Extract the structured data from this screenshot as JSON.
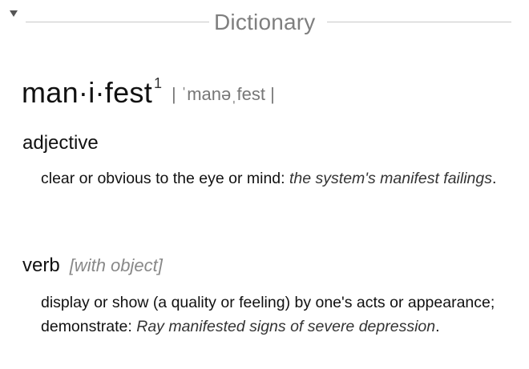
{
  "section": {
    "title": "Dictionary"
  },
  "entry": {
    "headword": "man·i·fest",
    "homograph": "1",
    "pronunciation": "| ˈmanəˌfest |",
    "senses": [
      {
        "pos": "adjective",
        "grammar": "",
        "definition": "clear or obvious to the eye or mind: ",
        "example": "the system's manifest failings",
        "trailing": "."
      },
      {
        "pos": "verb",
        "grammar": "[with object]",
        "definition": "display or show (a quality or feeling) by one's acts or appearance; demonstrate: ",
        "example": "Ray manifested signs of severe depression",
        "trailing": "."
      }
    ]
  }
}
